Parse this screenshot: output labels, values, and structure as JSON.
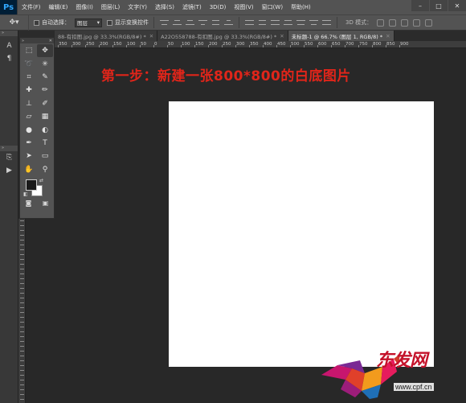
{
  "app": {
    "logo": "Ps"
  },
  "menu": [
    "文件(F)",
    "编辑(E)",
    "图像(I)",
    "图层(L)",
    "文字(Y)",
    "选择(S)",
    "滤镜(T)",
    "3D(D)",
    "视图(V)",
    "窗口(W)",
    "帮助(H)"
  ],
  "options": {
    "auto_select_label": "自动选择：",
    "auto_select_value": "图层",
    "show_transform_label": "显示变换控件",
    "mode_3d_label": "3D 模式："
  },
  "tabs": [
    {
      "label": "88-有扣图.jpg @ 33.3%(RGB/8#) *",
      "active": false
    },
    {
      "label": "A22O558788-有扣图.jpg @ 33.3%(RGB/8#) *",
      "active": false
    },
    {
      "label": "未标题-1 @ 66.7% (图层 1, RGB/8) *",
      "active": true
    }
  ],
  "ruler_top": [
    "350",
    "300",
    "250",
    "200",
    "150",
    "100",
    "50",
    "0",
    "50",
    "100",
    "150",
    "200",
    "250",
    "300",
    "350",
    "400",
    "450",
    "500",
    "550",
    "600",
    "650",
    "700",
    "750",
    "800",
    "850",
    "900"
  ],
  "canvas": {
    "headline": "第一步：新建一张800*800的白底图片"
  },
  "watermark": {
    "brand": "东发网",
    "url": "www.cpf.cn"
  },
  "colors": {
    "foreground": "#1a1a1a",
    "background": "#ffffff",
    "headline": "#e0251a",
    "watermark": "#c4122a"
  }
}
